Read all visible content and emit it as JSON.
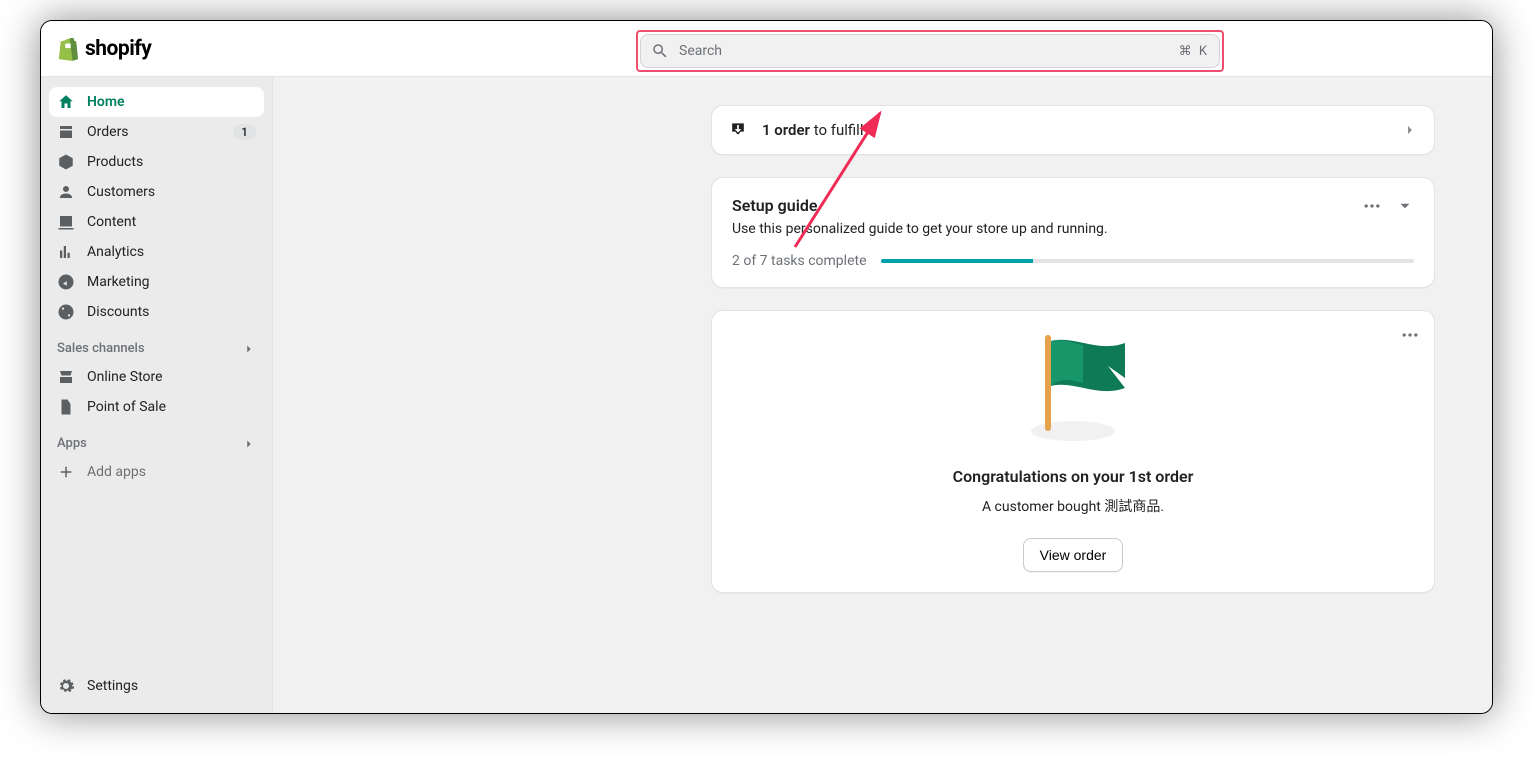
{
  "brand": "shopify",
  "search": {
    "placeholder": "Search",
    "shortcut": "⌘ K"
  },
  "sidebar": {
    "items": [
      {
        "label": "Home"
      },
      {
        "label": "Orders",
        "badge": "1"
      },
      {
        "label": "Products"
      },
      {
        "label": "Customers"
      },
      {
        "label": "Content"
      },
      {
        "label": "Analytics"
      },
      {
        "label": "Marketing"
      },
      {
        "label": "Discounts"
      }
    ],
    "sales_channels_label": "Sales channels",
    "channels": [
      {
        "label": "Online Store"
      },
      {
        "label": "Point of Sale"
      }
    ],
    "apps_label": "Apps",
    "add_apps_label": "Add apps",
    "settings_label": "Settings"
  },
  "fulfill": {
    "bold": "1 order",
    "rest": " to fulfill"
  },
  "setup": {
    "title": "Setup guide",
    "subtitle": "Use this personalized guide to get your store up and running.",
    "progress_text": "2 of 7 tasks complete"
  },
  "congrats": {
    "title": "Congratulations on your 1st order",
    "subtitle": "A customer bought 測試商品.",
    "button": "View order"
  }
}
